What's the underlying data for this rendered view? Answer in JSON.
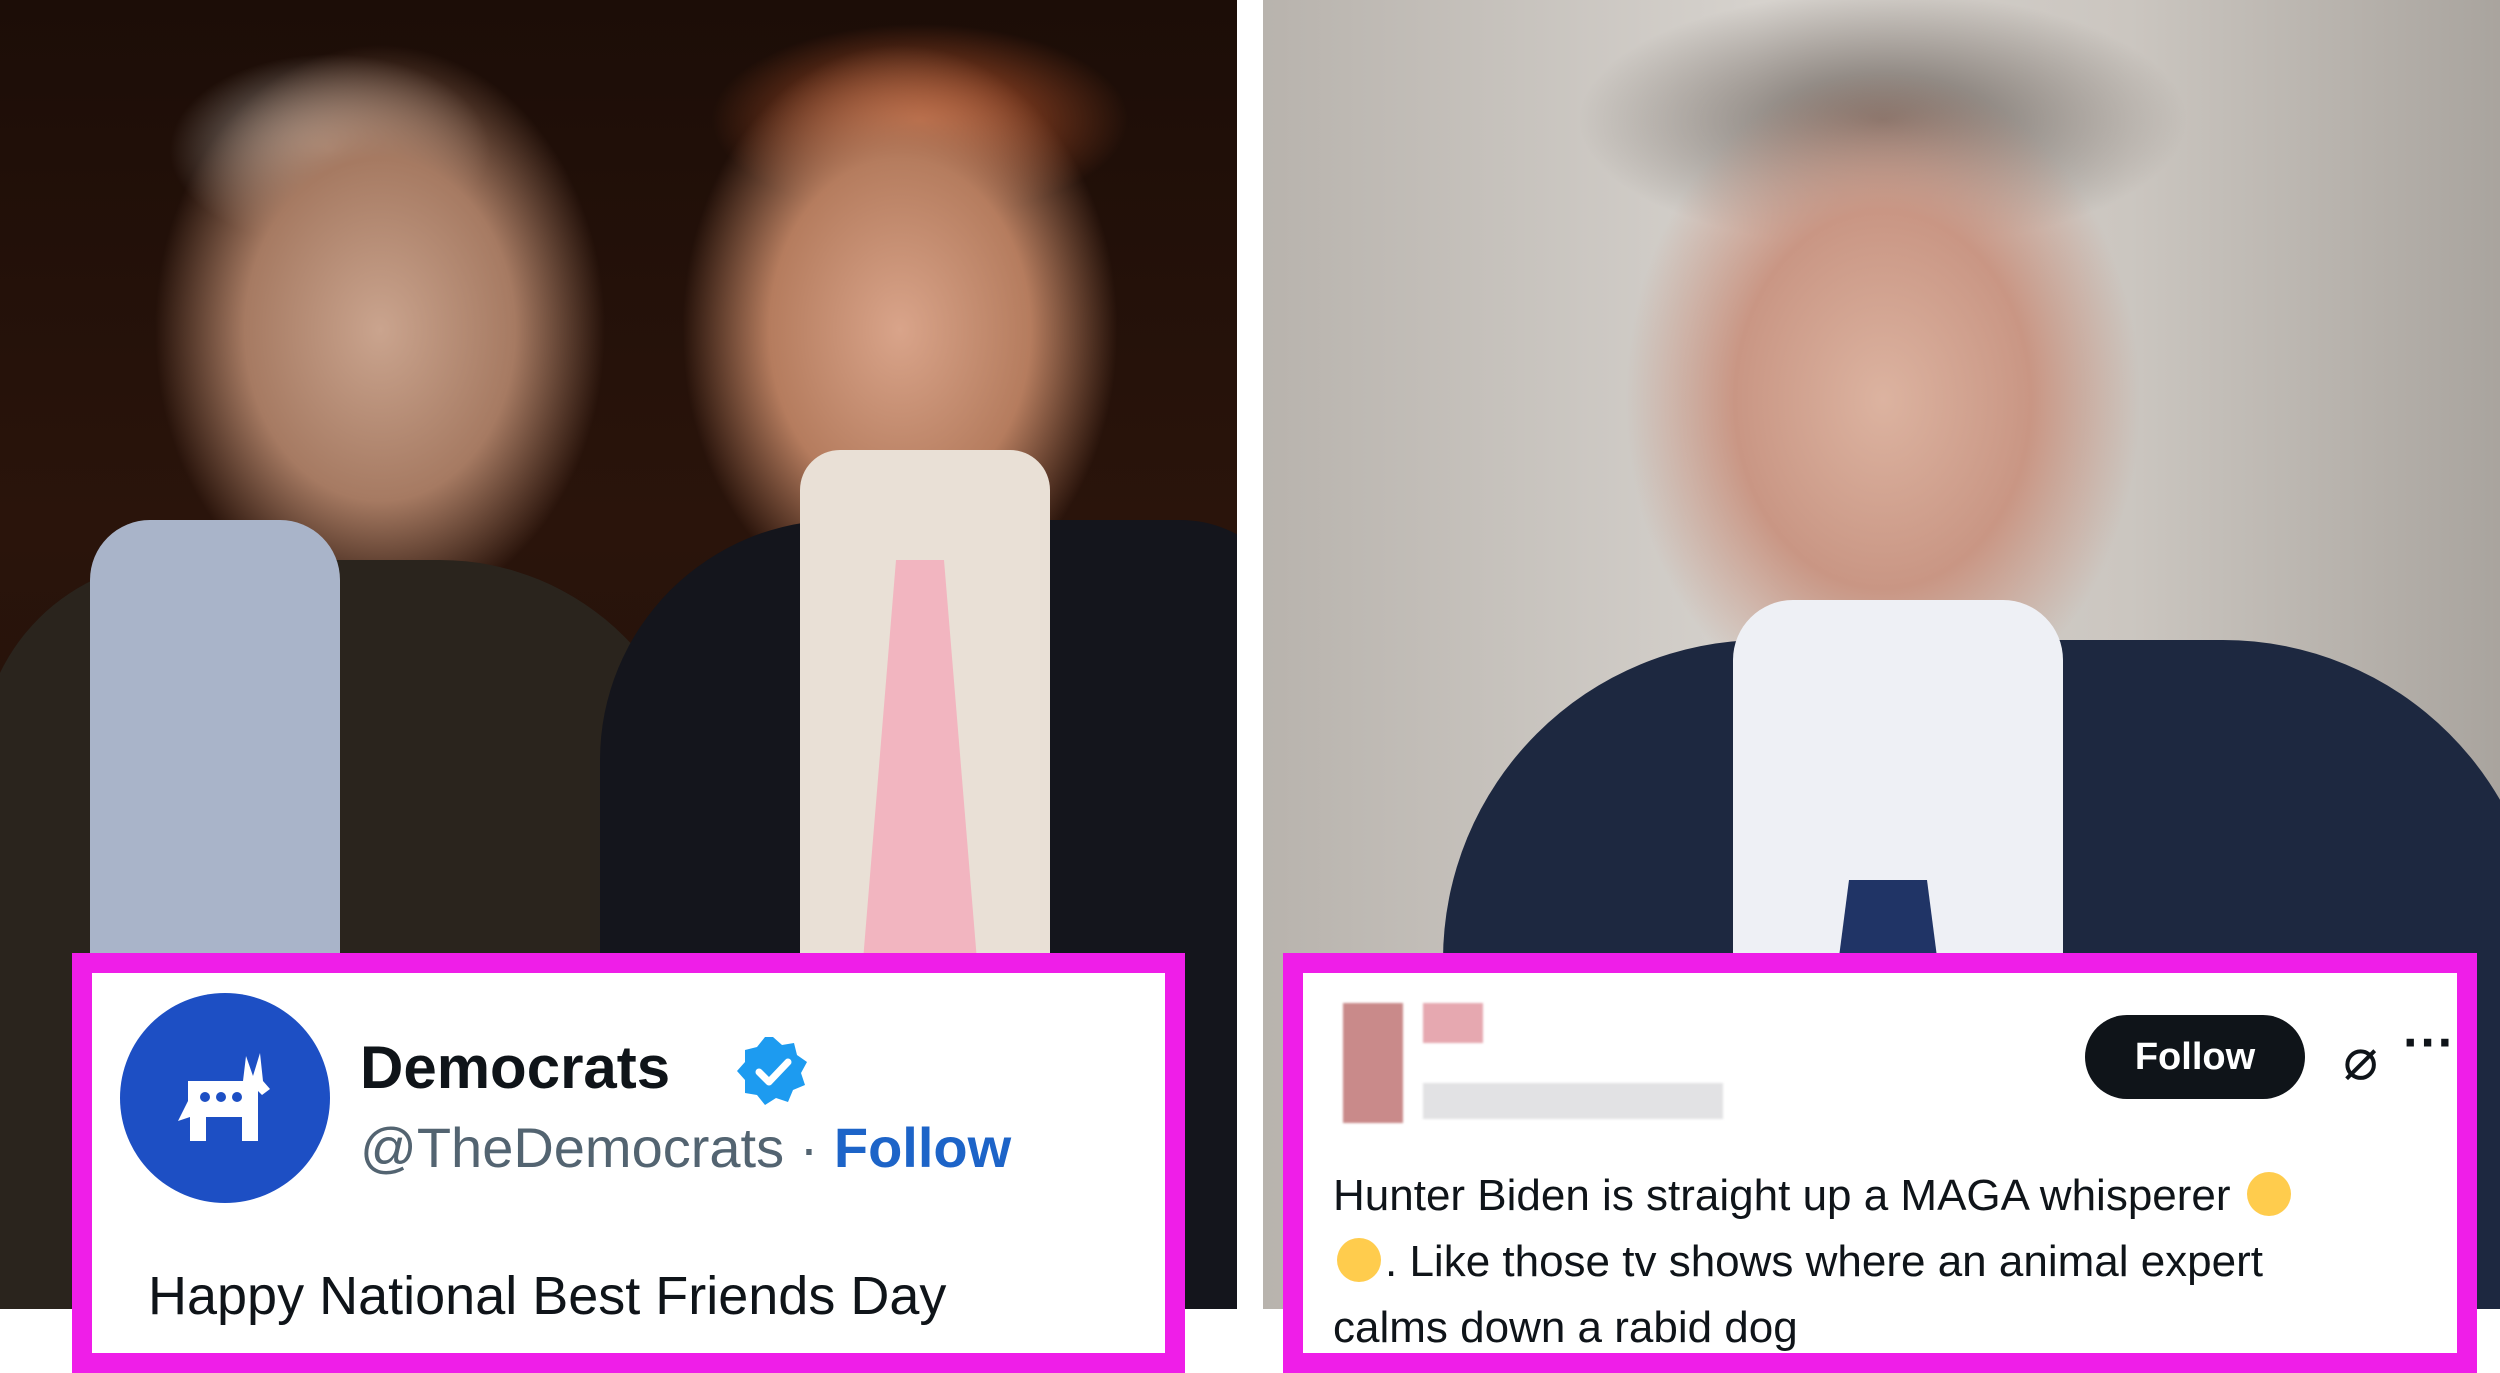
{
  "left_tweet": {
    "name": "Democrats",
    "handle": "@TheDemocrats",
    "separator": "·",
    "follow_label": "Follow",
    "text": "Happy National Best Friends Day"
  },
  "right_tweet": {
    "follow_label": "Follow",
    "text": "Hunter Biden is straight up a MAGA whisperer",
    "text_cont": ". Like those tv shows where an animal expert",
    "text_line3": "calms down a rabid dog"
  },
  "colors": {
    "highlight_border": "#ef1ee8",
    "democrats_blue": "#1d4fc4",
    "follow_link": "#1d64c8"
  }
}
